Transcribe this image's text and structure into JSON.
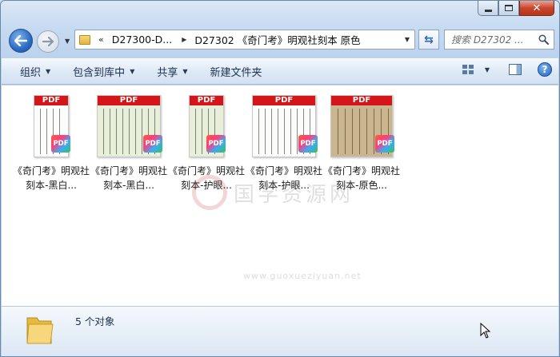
{
  "window": {
    "caption_buttons": {
      "minimize": "minimize",
      "maximize": "maximize",
      "close": "✕"
    }
  },
  "nav": {
    "address_overflow": "«",
    "breadcrumbs": [
      "D27300-D...",
      "D27302 《奇门考》明观社刻本 原色"
    ],
    "search_placeholder": "搜索 D27302 ..."
  },
  "toolbar": {
    "items": [
      "组织",
      "包含到库中",
      "共享",
      "新建文件夹"
    ]
  },
  "files": [
    {
      "badge": "PDF",
      "banner": "PDF",
      "label": "《奇门考》明观社刻本-黑白...",
      "style": "white"
    },
    {
      "badge": "PDF",
      "banner": "PDF",
      "label": "《奇门考》明观社刻本-黑白...",
      "style": "green"
    },
    {
      "badge": "PDF",
      "banner": "PDF",
      "label": "《奇门考》明观社刻本-护眼...",
      "style": "green"
    },
    {
      "badge": "PDF",
      "banner": "PDF",
      "label": "《奇门考》明观社刻本-护眼...",
      "style": "white"
    },
    {
      "badge": "PDF",
      "banner": "PDF",
      "label": "《奇门考》明观社刻本-原色...",
      "style": "sepia"
    }
  ],
  "watermark": {
    "text": "国学资源网",
    "url": "www.guoxueziyuan.net"
  },
  "details": {
    "count_text": "5 个对象"
  },
  "colors": {
    "pdf_banner": "#d4161a",
    "window_chrome": "#c7dbf1"
  }
}
